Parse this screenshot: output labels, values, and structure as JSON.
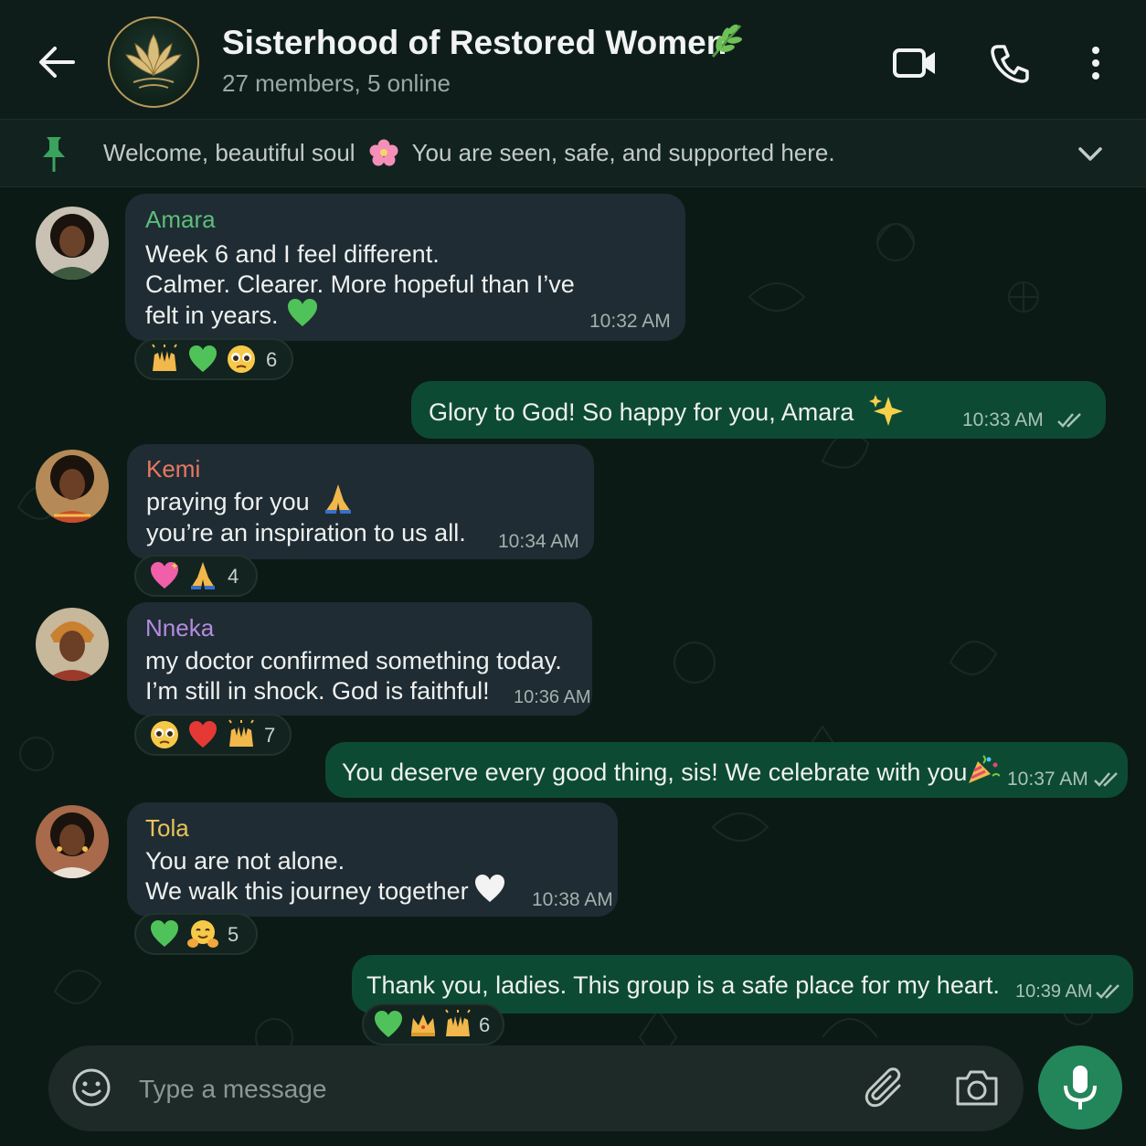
{
  "header": {
    "title": "Sisterhood of Restored Women",
    "subtitle": "27 members, 5 online",
    "title_emoji": "herb-emoji"
  },
  "pinned": {
    "text_before": "Welcome, beautiful soul",
    "text_after": "You are seen, safe, and supported here.",
    "emoji": "cherry-blossom-emoji"
  },
  "messages": [
    {
      "sender": "Amara",
      "sender_color": "#5dbd7a",
      "lines": [
        "Week 6 and I feel different.",
        "Calmer. Clearer. More hopeful than I’ve",
        "felt in years."
      ],
      "time": "10:32 AM",
      "reactions": {
        "emojis": [
          "raising-hands",
          "green-heart",
          "pleading-face"
        ],
        "count": "6"
      }
    },
    {
      "outgoing": true,
      "lines": [
        "Glory to God! So happy for you, Amara"
      ],
      "time": "10:33 AM",
      "status": "read"
    },
    {
      "sender": "Kemi",
      "sender_color": "#e87862",
      "lines": [
        "praying for you",
        "you’re an inspiration to us all."
      ],
      "time": "10:34 AM",
      "reactions": {
        "emojis": [
          "sparkling-heart",
          "folded-hands"
        ],
        "count": "4"
      }
    },
    {
      "sender": "Nneka",
      "sender_color": "#b48be0",
      "lines": [
        "my doctor confirmed something today.",
        "I’m still in shock. God is faithful!"
      ],
      "time": "10:36 AM",
      "reactions": {
        "emojis": [
          "pleading-face",
          "red-heart",
          "raising-hands"
        ],
        "count": "7"
      }
    },
    {
      "outgoing": true,
      "lines": [
        "You deserve every good thing, sis! We celebrate with you"
      ],
      "time": "10:37 AM",
      "status": "read"
    },
    {
      "sender": "Tola",
      "sender_color": "#e8c25a",
      "lines": [
        "You are not alone.",
        "We walk this journey together"
      ],
      "time": "10:38 AM",
      "reactions": {
        "emojis": [
          "green-heart",
          "hugging-face"
        ],
        "count": "5"
      }
    },
    {
      "outgoing": true,
      "lines": [
        "Thank you, ladies. This group is a safe place for my heart."
      ],
      "time": "10:39 AM",
      "status": "read",
      "reactions": {
        "emojis": [
          "green-heart",
          "crown",
          "raising-hands"
        ],
        "count": "6"
      }
    }
  ],
  "composer": {
    "placeholder": "Type a message"
  },
  "colors": {
    "background": "#0c1a16",
    "incoming_bubble": "#1f2c33",
    "outgoing_bubble": "#0d4a34",
    "accent": "#23865a"
  }
}
